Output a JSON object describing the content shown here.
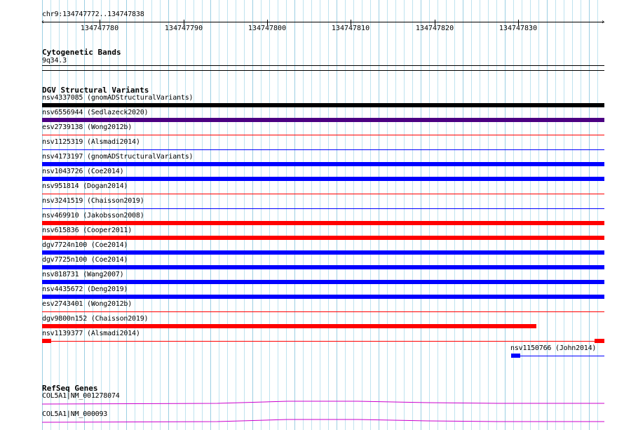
{
  "ruler": {
    "location": "chr9:134747772..134747838",
    "ticks": [
      "134747780",
      "134747790",
      "134747800",
      "134747810",
      "134747820",
      "134747830"
    ],
    "left_arrow": "‹",
    "right_arrow": "›"
  },
  "cytoband": {
    "title": "Cytogenetic Bands",
    "band": "9q34.3"
  },
  "dgv": {
    "title": "DGV Structural Variants",
    "variants": [
      {
        "label": "nsv4337085 (gnomADStructuralVariants)",
        "color": "#000000",
        "type": "bar"
      },
      {
        "label": "nsv6556944 (Sedlazeck2020)",
        "color": "#4b0082",
        "type": "bar"
      },
      {
        "label": "esv2739138 (Wong2012b)",
        "color": "#ff0000",
        "type": "line"
      },
      {
        "label": "nsv1125319 (Alsmadi2014)",
        "color": "#0000ff",
        "type": "line"
      },
      {
        "label": "nsv4173197 (gnomADStructuralVariants)",
        "color": "#0000ff",
        "type": "bar"
      },
      {
        "label": "nsv1043726 (Coe2014)",
        "color": "#0000ff",
        "type": "bar"
      },
      {
        "label": "nsv951814 (Dogan2014)",
        "color": "#ff0000",
        "type": "line"
      },
      {
        "label": "nsv3241519 (Chaisson2019)",
        "color": "#0000ff",
        "type": "line"
      },
      {
        "label": "nsv469910 (Jakobsson2008)",
        "color": "#ff0000",
        "type": "bar"
      },
      {
        "label": "nsv615836 (Cooper2011)",
        "color": "#ff0000",
        "type": "bar"
      },
      {
        "label": "dgv7724n100 (Coe2014)",
        "color": "#0000ff",
        "type": "bar"
      },
      {
        "label": "dgv7725n100 (Coe2014)",
        "color": "#0000ff",
        "type": "bar"
      },
      {
        "label": "nsv818731 (Wang2007)",
        "color": "#0000ff",
        "type": "bar"
      },
      {
        "label": "nsv4435672 (Deng2019)",
        "color": "#0000ff",
        "type": "bar"
      },
      {
        "label": "esv2743401 (Wong2012b)",
        "color": "#ff0000",
        "type": "line"
      },
      {
        "label": "dgv9800n152 (Chaisson2019)",
        "color": "#ff0000",
        "type": "bar-partial"
      },
      {
        "label": "nsv1139377 (Alsmadi2014)",
        "color": "#ff0000",
        "type": "line-ends"
      },
      {
        "label": "nsv1150766 (John2014)",
        "color": "#0000ff",
        "type": "line-start-block"
      }
    ]
  },
  "refseq": {
    "title": "RefSeq Genes",
    "genes": [
      {
        "label": "COL5A1|NM_001278074",
        "color": "#cc00cc"
      },
      {
        "label": "COL5A1|NM_000093",
        "color": "#cc00cc"
      }
    ]
  }
}
